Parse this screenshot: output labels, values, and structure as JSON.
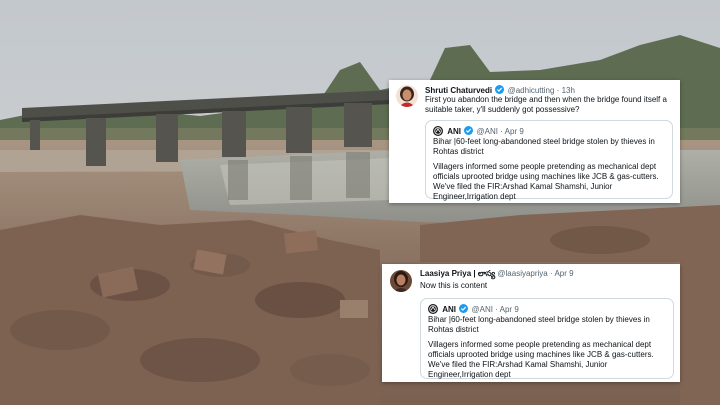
{
  "tweets": [
    {
      "name": "Shruti Chaturvedi",
      "handle": "@adhicutting",
      "sep": "·",
      "time": "13h",
      "text": "First you abandon the bridge and then when the bridge found itself a suitable taker, y'll suddenly got possessive?",
      "quote": {
        "name": "ANI",
        "handle": "@ANI",
        "sep": "·",
        "time": "Apr 9",
        "text1": "Bihar |60-feet long-abandoned steel bridge stolen by thieves in Rohtas district",
        "text2": "Villagers informed some people pretending as mechanical dept officials uprooted bridge using machines like JCB & gas-cutters. We've filed the FIR:Arshad Kamal Shamshi, Junior Engineer,Irrigation dept"
      }
    },
    {
      "name": "Laasiya Priya | లాస్య",
      "handle": "@laasiyapriya",
      "sep": "·",
      "time": "Apr 9",
      "text": "Now this is content",
      "quote": {
        "name": "ANI",
        "handle": "@ANI",
        "sep": "·",
        "time": "Apr 9",
        "text1": "Bihar |60-feet long-abandoned steel bridge stolen by thieves in Rohtas district",
        "text2": "Villagers informed some people pretending as mechanical dept officials uprooted bridge using machines like JCB & gas-cutters. We've filed the FIR:Arshad Kamal Shamshi, Junior Engineer,Irrigation dept"
      }
    }
  ],
  "colors": {
    "verified": "#1d9bf0",
    "muted": "#536471",
    "border": "#cfd9de",
    "sky": "#c9ced3",
    "water": "#9fa39e",
    "ground": "#8c7664"
  }
}
